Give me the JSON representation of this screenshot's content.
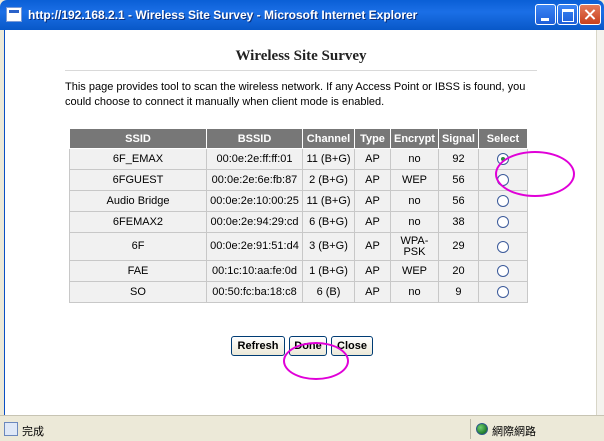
{
  "window": {
    "title": "http://192.168.2.1 - Wireless Site Survey - Microsoft Internet Explorer"
  },
  "page": {
    "heading": "Wireless Site Survey",
    "description": "This page provides tool to scan the wireless network. If any Access Point or IBSS is found, you could choose to connect it manually when client mode is enabled."
  },
  "table": {
    "headers": [
      "SSID",
      "BSSID",
      "Channel",
      "Type",
      "Encrypt",
      "Signal",
      "Select"
    ],
    "rows": [
      {
        "ssid": "6F_EMAX",
        "bssid": "00:0e:2e:ff:ff:01",
        "channel": "11 (B+G)",
        "type": "AP",
        "encrypt": "no",
        "signal": "92",
        "selected": true
      },
      {
        "ssid": "6FGUEST",
        "bssid": "00:0e:2e:6e:fb:87",
        "channel": "2 (B+G)",
        "type": "AP",
        "encrypt": "WEP",
        "signal": "56",
        "selected": false
      },
      {
        "ssid": "Audio Bridge",
        "bssid": "00:0e:2e:10:00:25",
        "channel": "11 (B+G)",
        "type": "AP",
        "encrypt": "no",
        "signal": "56",
        "selected": false
      },
      {
        "ssid": "6FEMAX2",
        "bssid": "00:0e:2e:94:29:cd",
        "channel": "6 (B+G)",
        "type": "AP",
        "encrypt": "no",
        "signal": "38",
        "selected": false
      },
      {
        "ssid": "6F",
        "bssid": "00:0e:2e:91:51:d4",
        "channel": "3 (B+G)",
        "type": "AP",
        "encrypt": "WPA-PSK",
        "signal": "29",
        "selected": false
      },
      {
        "ssid": "FAE",
        "bssid": "00:1c:10:aa:fe:0d",
        "channel": "1 (B+G)",
        "type": "AP",
        "encrypt": "WEP",
        "signal": "20",
        "selected": false
      },
      {
        "ssid": "SO",
        "bssid": "00:50:fc:ba:18:c8",
        "channel": "6 (B)",
        "type": "AP",
        "encrypt": "no",
        "signal": "9",
        "selected": false
      }
    ]
  },
  "buttons": {
    "refresh": "Refresh",
    "done": "Done",
    "close": "Close"
  },
  "status": {
    "text": "完成",
    "zone": "網際網路"
  },
  "colors": {
    "annotation": "#e000d8",
    "header_bg": "#777777"
  }
}
